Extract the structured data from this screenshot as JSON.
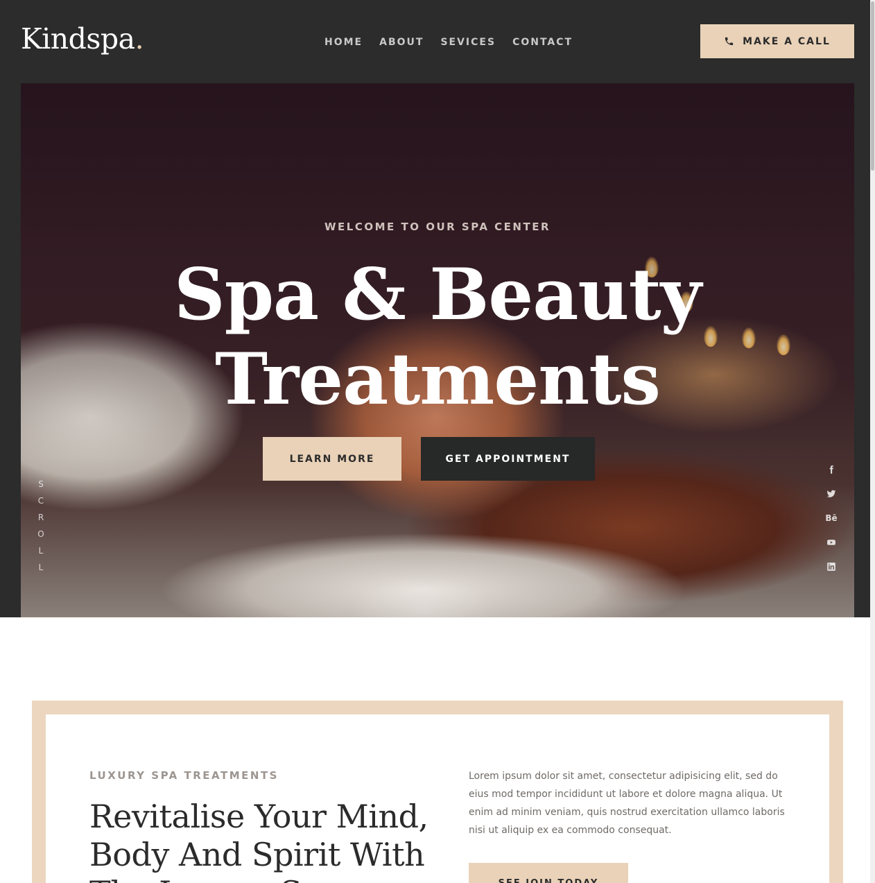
{
  "brand": {
    "name": "Kindspa",
    "dot": "."
  },
  "nav": [
    {
      "label": "HOME"
    },
    {
      "label": "ABOUT"
    },
    {
      "label": "SEVICES"
    },
    {
      "label": "CONTACT"
    }
  ],
  "header": {
    "call_label": "MAKE A CALL",
    "call_icon": "phone-icon"
  },
  "hero": {
    "eyebrow": "WELCOME TO OUR SPA CENTER",
    "title_line1": "Spa & Beauty",
    "title_line2": "Treatments",
    "learn_more": "LEARN MORE",
    "get_appointment": "GET APPOINTMENT",
    "scroll_label": "SCROLL",
    "social_icons": [
      "facebook-icon",
      "twitter-icon",
      "behance-icon",
      "youtube-icon",
      "linkedin-icon"
    ],
    "behance_text": "Bē"
  },
  "about": {
    "eyebrow": "LUXURY SPA TREATMENTS",
    "title": "Revitalise Your Mind, Body And Spirit With The Luxury Spa",
    "text": "Lorem ipsum dolor sit amet, consectetur adipisicing elit, sed do eius mod tempor incididunt ut labore et dolore magna aliqua. Ut enim ad minim veniam, quis nostrud exercitation ullamco laboris nisi ut aliquip ex ea commodo consequat.",
    "join_label": "SEE JOIN TODAY"
  },
  "colors": {
    "dark": "#2b2c2b",
    "accent_beige": "#e9d2b8",
    "white": "#ffffff"
  }
}
